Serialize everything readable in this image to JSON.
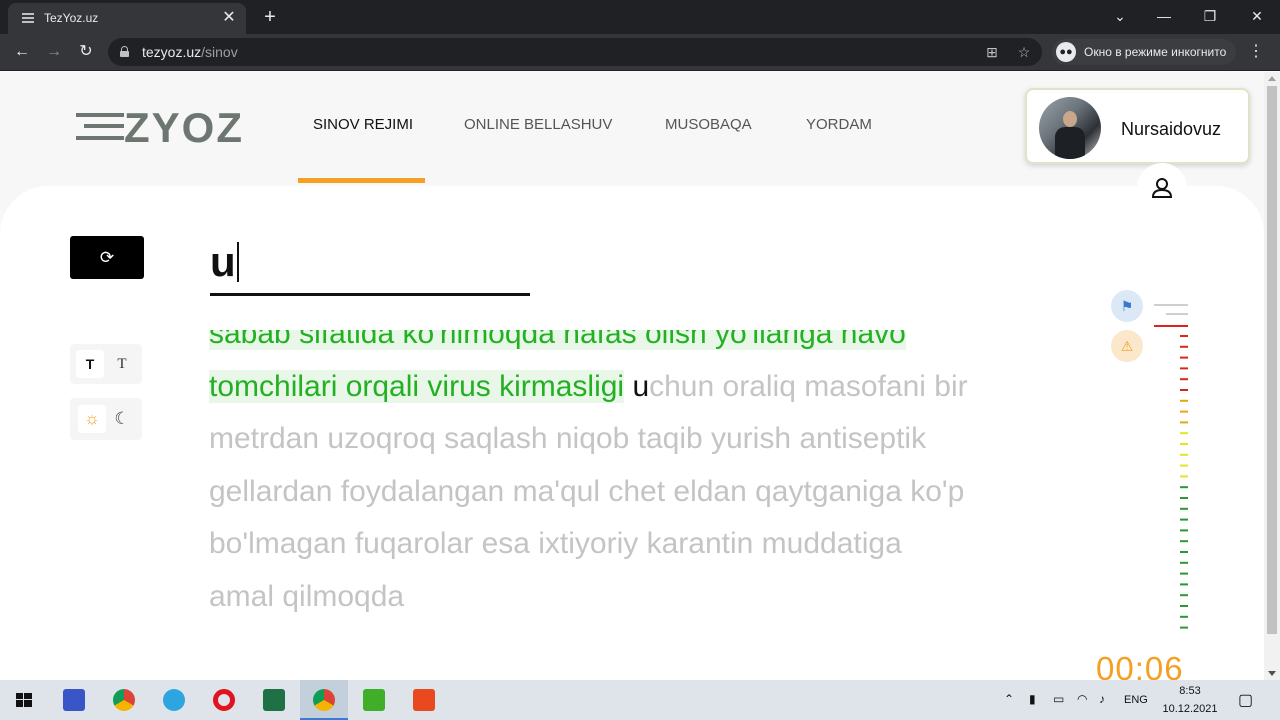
{
  "browser": {
    "tab_title": "TezYoz.uz",
    "url_host": "tezyoz.uz",
    "url_path": "/sinov",
    "incognito_label": "Окно в режиме инкогнито"
  },
  "site": {
    "logo": "ZYOZ",
    "nav": {
      "sinov": "SINOV REJIMI",
      "online": "ONLINE BELLASHUV",
      "musobaqa": "MUSOBAQA",
      "yordam": "YORDAM"
    },
    "active_nav": "SINOV REJIMI",
    "user_name": "Nursaidovuz"
  },
  "typing": {
    "input_value": "u",
    "typed_text": "sabab sifatida ko'rilmoqda nafas olish yo'llariga havo tomchilari orqali virus kirmasligi",
    "current_char": "u",
    "remaining_text": "chun oraliq masofani bir metrdan uzoqroq saqlash niqob taqib yurish antiseptik gellardan foydalangan ma'qul chet eldan qaytganiga ko'p bo'lmagan fuqarolar esa ixtiyoriy karantin muddatiga amal qilmoqda",
    "font_toggle_bold": "T",
    "font_toggle_serif": "T",
    "timer": "00:06"
  },
  "taskbar": {
    "language": "ENG",
    "time": "8:53",
    "date": "10.12.2021"
  },
  "colors": {
    "accent_orange": "#f4a024",
    "correct_green": "#23b023",
    "correct_bg": "#e8f7e8",
    "pending_gray": "#c4c4c4"
  },
  "icons": {
    "restart": "refresh-icon",
    "sun": "sun-icon",
    "moon": "moon-icon",
    "flag": "flag-icon",
    "warning": "warning-icon",
    "user": "user-icon"
  }
}
